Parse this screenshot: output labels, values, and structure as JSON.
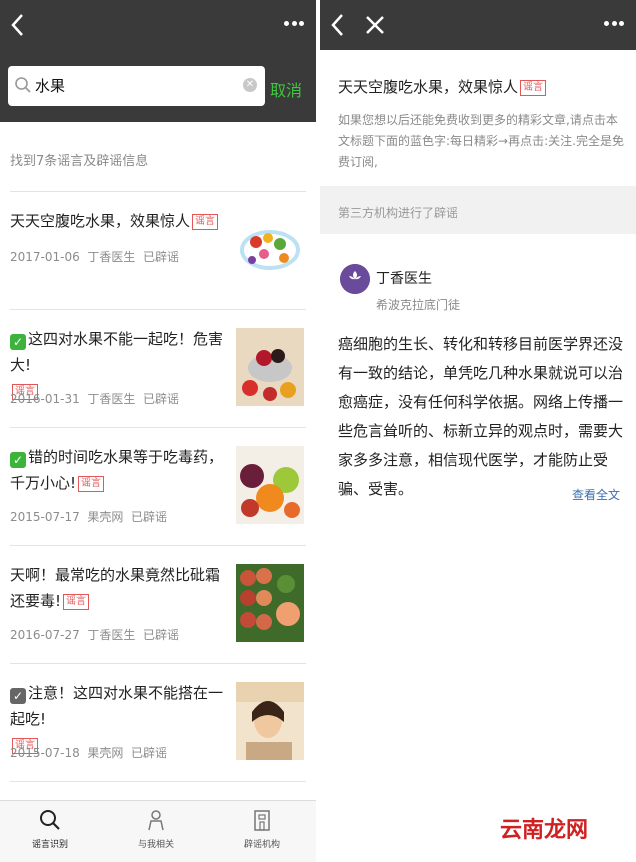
{
  "left": {
    "search": {
      "value": "水果",
      "cancel_label": "取消"
    },
    "result_count": "找到7条谣言及辟谣信息",
    "items": [
      {
        "title": "天天空腹吃水果，效果惊人",
        "tag": "谣言",
        "date": "2017-01-06",
        "source": "丁香医生",
        "status": "已辟谣",
        "badge": ""
      },
      {
        "title": "这四对水果不能一起吃！危害大!",
        "tag": "谣言",
        "date": "2016-01-31",
        "source": "丁香医生",
        "status": "已辟谣",
        "badge": "green-check"
      },
      {
        "title": "错的时间吃水果等于吃毒药，千万小心!",
        "tag": "谣言",
        "date": "2015-07-17",
        "source": "果壳网",
        "status": "已辟谣",
        "badge": "green-check"
      },
      {
        "title": "天啊！最常吃的水果竟然比砒霜还要毒!",
        "tag": "谣言",
        "date": "2016-07-27",
        "source": "丁香医生",
        "status": "已辟谣",
        "badge": ""
      },
      {
        "title": "注意！这四对水果不能搭在一起吃!",
        "tag": "谣言",
        "date": "2015-07-18",
        "source": "果壳网",
        "status": "已辟谣",
        "badge": "gray-check"
      }
    ],
    "tabs": [
      {
        "label": "谣言识别",
        "icon": "search-icon",
        "active": true
      },
      {
        "label": "与我相关",
        "icon": "person-icon",
        "active": false
      },
      {
        "label": "辟谣机构",
        "icon": "building-icon",
        "active": false
      }
    ]
  },
  "right": {
    "title": "天天空腹吃水果，效果惊人",
    "tag": "谣言",
    "description": "如果您想以后还能免费收到更多的精彩文章,请点击本文标题下面的蓝色字:每日精彩→再点击:关注.完全是免费订阅,",
    "section_label": "第三方机构进行了辟谣",
    "org": {
      "name": "丁香医生",
      "subtitle": "希波克拉底门徒",
      "avatar_text": "丁香医生"
    },
    "body": "癌细胞的生长、转化和转移目前医学界还没有一致的结论，单凭吃几种水果就说可以治愈癌症，没有任何科学依据。网络上传播一些危言耸听的、标新立异的观点时，需要大家多多注意，相信现代医学，才能防止受骗、受害。",
    "read_all": "查看全文"
  },
  "watermark": "云南龙网",
  "colors": {
    "topbar": "#3a3a3a",
    "accent_green": "#3ec63e",
    "rumor_red": "#e25858",
    "link_blue": "#3a6fb0"
  }
}
